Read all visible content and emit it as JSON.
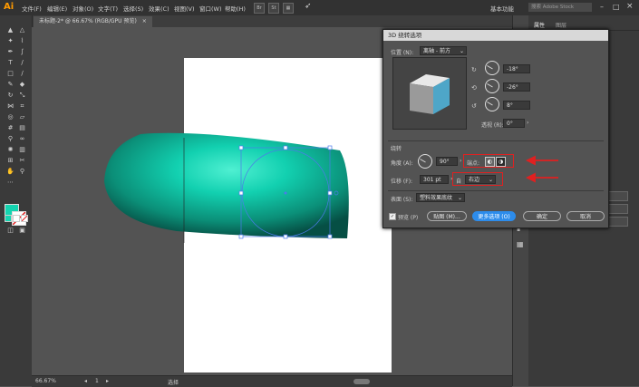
{
  "app": {
    "logo": "Ai",
    "workspace": "基本功能",
    "search_placeholder": "搜索 Adobe Stock"
  },
  "menu": [
    "文件(F)",
    "编辑(E)",
    "对象(O)",
    "文字(T)",
    "选择(S)",
    "效果(C)",
    "视图(V)",
    "窗口(W)",
    "帮助(H)"
  ],
  "bridge_buttons": [
    "Br",
    "St"
  ],
  "document_tab": {
    "title": "未标题-2* @ 66.67% (RGB/GPU 预览)",
    "close": "×"
  },
  "status": {
    "zoom": "66.67%",
    "artboard": "1",
    "tool": "选择"
  },
  "right_panel": {
    "tab1": "属性",
    "tab2": "图层"
  },
  "colors": {
    "fill": "#14d4b0",
    "accent_button": "#2d8ceb",
    "highlight_red": "#e02020"
  },
  "dialog": {
    "title": "3D 绕转选项",
    "position_label": "位置 (N):",
    "position_value": "离轴 - 前方",
    "rot_x": "-18°",
    "rot_y": "-26°",
    "rot_z": "8°",
    "perspective_label": "透视 (R):",
    "perspective_value": "0°",
    "revolve_header": "绕转",
    "angle_label": "角度 (A):",
    "angle_value": "90°",
    "cap_label": "端点:",
    "offset_label": "位移 (F):",
    "offset_value": "301 pt",
    "offset_from_label": "自",
    "offset_from_value": "右边",
    "surface_label": "表面 (S):",
    "surface_value": "塑料效果底纹",
    "preview_label": "预览 (P)",
    "map_button": "贴图 (M)...",
    "more_button": "更多选项 (O)",
    "ok_button": "确定",
    "cancel_button": "取消"
  }
}
